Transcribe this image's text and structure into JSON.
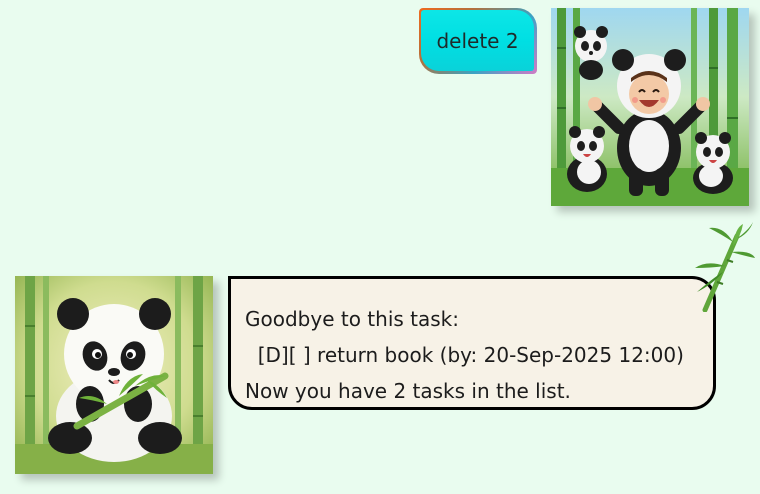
{
  "messages": {
    "user": {
      "text": "delete 2"
    },
    "bot": {
      "line1": "Goodbye to this task:",
      "line2": "  [D][ ] return book (by: 20-Sep-2025 12:00)",
      "line3": "Now you have 2 tasks in the list."
    }
  },
  "colors": {
    "background": "#e9fcef",
    "user_bubble": "#00dfe3",
    "bot_bubble": "#f7f2e7",
    "bot_border": "#000000"
  },
  "icons": {
    "user_avatar": "child-in-panda-costume-avatar",
    "bot_avatar": "baby-panda-eating-bamboo-avatar",
    "decoration": "bamboo-leaves-icon"
  }
}
